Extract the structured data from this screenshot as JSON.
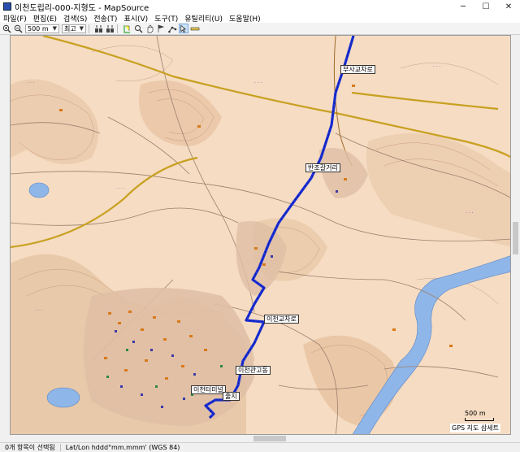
{
  "window": {
    "title": "이천도립리-000-지형도 - MapSource",
    "minimize": "─",
    "maximize": "☐",
    "close": "✕"
  },
  "menu": [
    "파일(F)",
    "편집(E)",
    "검색(S)",
    "전송(T)",
    "표시(V)",
    "도구(T)",
    "유틸리티(U)",
    "도움말(H)"
  ],
  "toolbar": {
    "zoom_value": "500 m",
    "detail_value": "최고"
  },
  "map": {
    "labels": [
      {
        "key": "l1",
        "text": "부사교차로"
      },
      {
        "key": "l2",
        "text": "반조갈거리"
      },
      {
        "key": "l3",
        "text": "이천교차로"
      },
      {
        "key": "l4",
        "text": "이천관고동"
      },
      {
        "key": "l5",
        "text": "이천터미널"
      },
      {
        "key": "l6",
        "text": "출지"
      }
    ],
    "scale_label": "500 m",
    "credit": "GPS 지도 삼세트"
  },
  "status": {
    "selection": "0개 항목이 선택됨",
    "coords": "Lat/Lon hddd°mm.mmm' (WGS 84)"
  },
  "colors": {
    "map_bg": "#f5dcc2",
    "road_major": "#c8a020",
    "route": "#1a2fd8",
    "water": "#8fb6e8"
  }
}
